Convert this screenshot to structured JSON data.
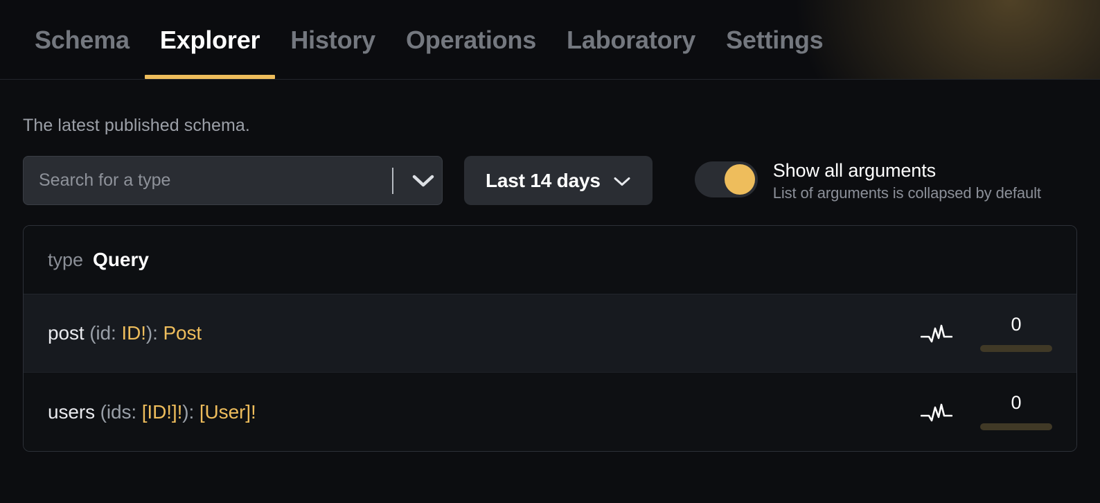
{
  "nav": {
    "tabs": [
      {
        "label": "Schema",
        "active": false
      },
      {
        "label": "Explorer",
        "active": true
      },
      {
        "label": "History",
        "active": false
      },
      {
        "label": "Operations",
        "active": false
      },
      {
        "label": "Laboratory",
        "active": false
      },
      {
        "label": "Settings",
        "active": false
      }
    ],
    "active_indicator_color": "#eebd5c"
  },
  "page": {
    "subtitle": "The latest published schema."
  },
  "controls": {
    "search": {
      "placeholder": "Search for a type",
      "value": "",
      "chevron_icon": "chevron-down-icon"
    },
    "period": {
      "label": "Last 14 days",
      "chevron_icon": "chevron-down-icon"
    },
    "show_all_arguments": {
      "title": "Show all arguments",
      "description": "List of arguments is collapsed by default",
      "enabled": true,
      "accent_color": "#eebd5c"
    }
  },
  "schema": {
    "keyword": "type",
    "type_name": "Query",
    "fields": [
      {
        "name": "post",
        "args_open": " (id: ",
        "arg_type": "ID!",
        "args_close": "): ",
        "return_type": "Post",
        "metric_icon": "activity-pulse-icon",
        "metric_value": "0",
        "metric_percent": 0
      },
      {
        "name": "users",
        "args_open": " (ids: ",
        "arg_type": "[ID!]!",
        "args_close": "): ",
        "return_type": "[User]!",
        "metric_icon": "activity-pulse-icon",
        "metric_value": "0",
        "metric_percent": 0
      }
    ]
  }
}
